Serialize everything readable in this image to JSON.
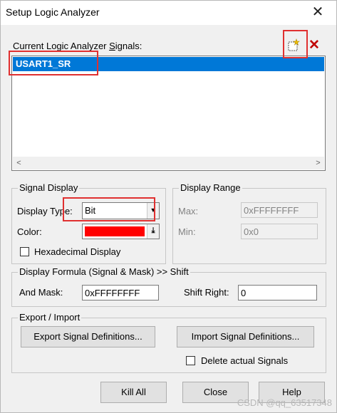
{
  "window": {
    "title": "Setup Logic Analyzer",
    "close_glyph": "✕"
  },
  "signals": {
    "label_pre": "Current Logic Analyzer ",
    "label_ul": "S",
    "label_post": "ignals:",
    "items": [
      "USART1_SR"
    ],
    "selected": "USART1_SR",
    "scroll_left": "<",
    "scroll_right": ">"
  },
  "toolbar": {
    "new_icon": "new-signal-icon",
    "delete_icon": "delete-signal-icon",
    "delete_glyph": "✕"
  },
  "signal_display": {
    "title": "Signal Display",
    "display_type_label": "Display Type:",
    "display_type_value": "Bit",
    "color_label": "Color:",
    "color_value": "#ff0000",
    "hex_label": "Hexadecimal Display",
    "hex_checked": false
  },
  "display_range": {
    "title": "Display Range",
    "max_label": "Max:",
    "max_value": "0xFFFFFFFF",
    "min_label": "Min:",
    "min_value": "0x0"
  },
  "formula": {
    "title": "Display Formula (Signal & Mask) >> Shift",
    "and_mask_label": "And Mask:",
    "and_mask_value": "0xFFFFFFFF",
    "shift_label": "Shift Right:",
    "shift_value": "0"
  },
  "export_import": {
    "title": "Export / Import",
    "export_button": "Export Signal Definitions...",
    "import_button": "Import Signal Definitions...",
    "delete_actual_label": "Delete actual Signals",
    "delete_actual_checked": false
  },
  "buttons": {
    "kill_all": "Kill All",
    "close": "Close",
    "help": "Help"
  },
  "watermark": "CSDN @qq_63517348",
  "colors": {
    "selection": "#0078d7",
    "highlight": "#e03030"
  }
}
